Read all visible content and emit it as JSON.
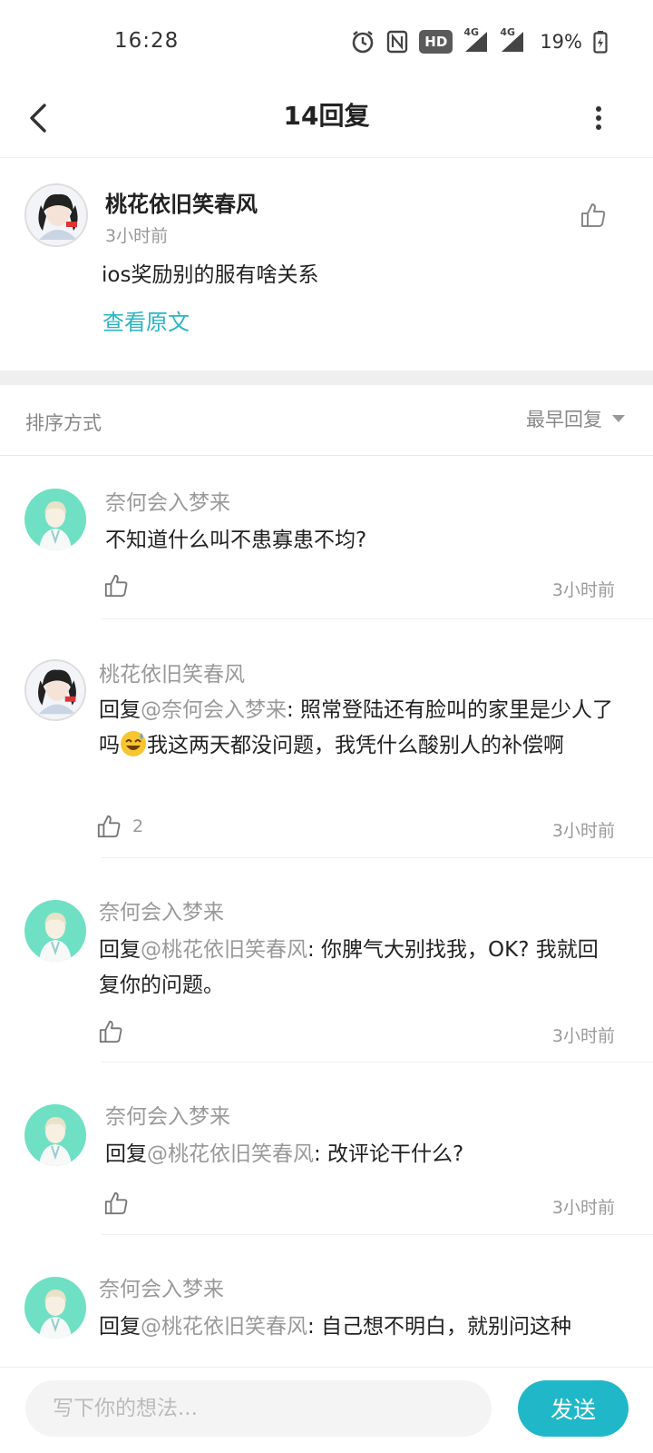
{
  "status_bar": {
    "time": "16:28",
    "hd_label": "HD",
    "network_labels": [
      "4G",
      "4G"
    ],
    "battery": "19%",
    "icons": [
      "alarm-icon",
      "nfc-icon",
      "hd-icon",
      "signal-icon",
      "signal-icon",
      "battery-icon"
    ]
  },
  "header": {
    "title": "14回复",
    "back_icon": "chevron-left-icon",
    "more_icon": "more-vertical-icon"
  },
  "original": {
    "name": "桃花依旧笑春风",
    "time": "3小时前",
    "text": "ios奖励别的服有啥关系",
    "link_label": "查看原文",
    "like_icon": "thumbs-up-icon"
  },
  "sort": {
    "label": "排序方式",
    "selected": "最早回复"
  },
  "replies": [
    {
      "name": "奈何会入梦来",
      "prefix": "",
      "mention": "",
      "text": "不知道什么叫不患寡患不均?",
      "text_after": "",
      "likes": "",
      "time": "3小时前"
    },
    {
      "name": "桃花依旧笑春风",
      "prefix": "回复",
      "mention": "@奈何会入梦来",
      "text": ": 照常登陆还有脸叫的家里是少人了吗",
      "text_after": "我这两天都没问题，我凭什么酸别人的补偿啊",
      "likes": "2",
      "time": "3小时前"
    },
    {
      "name": "奈何会入梦来",
      "prefix": "回复",
      "mention": "@桃花依旧笑春风",
      "text": ": 你脾气大别找我，OK? 我就回复你的问题。",
      "text_after": "",
      "likes": "",
      "time": "3小时前"
    },
    {
      "name": "奈何会入梦来",
      "prefix": "回复",
      "mention": "@桃花依旧笑春风",
      "text": ": 改评论干什么?",
      "text_after": "",
      "likes": "",
      "time": "3小时前"
    },
    {
      "name": "奈何会入梦来",
      "prefix": "回复",
      "mention": "@桃花依旧笑春风",
      "text": ": 自己想不明白，就别问这种",
      "text_after": "",
      "likes": "",
      "time": ""
    }
  ],
  "input": {
    "placeholder": "写下你的想法...",
    "send_label": "发送"
  },
  "colors": {
    "accent": "#20b8c8",
    "link": "#2bb4c4",
    "muted": "#999999"
  }
}
